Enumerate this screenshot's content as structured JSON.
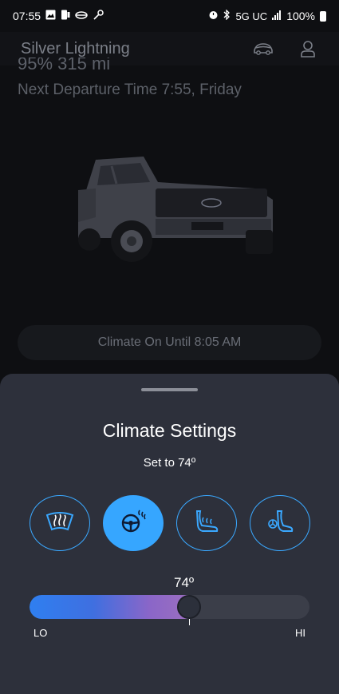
{
  "status_bar": {
    "time": "07:55",
    "network": "5G UC",
    "battery": "100%"
  },
  "header": {
    "vehicle_name": "Silver Lightning",
    "icons": [
      "vehicle-icon",
      "account-icon"
    ]
  },
  "vehicle": {
    "range_text": "95% 315 mi",
    "departure_text": "Next Departure Time 7:55, Friday",
    "climate_status": "Climate On Until 8:05 AM"
  },
  "climate_sheet": {
    "title": "Climate Settings",
    "set_to": "Set to 74º",
    "controls": [
      {
        "name": "front-defrost",
        "icon": "windshield-defrost-icon",
        "active": false
      },
      {
        "name": "heated-steering-wheel",
        "icon": "heated-steering-wheel-icon",
        "active": true
      },
      {
        "name": "heated-seat",
        "icon": "heated-seat-icon",
        "active": false
      },
      {
        "name": "ventilated-seat",
        "icon": "ventilated-seat-icon",
        "active": false
      }
    ],
    "temperature": {
      "value_label": "74º",
      "level": 0.57,
      "lo_label": "LO",
      "hi_label": "HI"
    },
    "colors": {
      "accent": "#36a6ff",
      "sheet_bg": "#2d303b",
      "gradient_start": "#2f7ff0",
      "gradient_end": "#9b6ec0"
    }
  }
}
